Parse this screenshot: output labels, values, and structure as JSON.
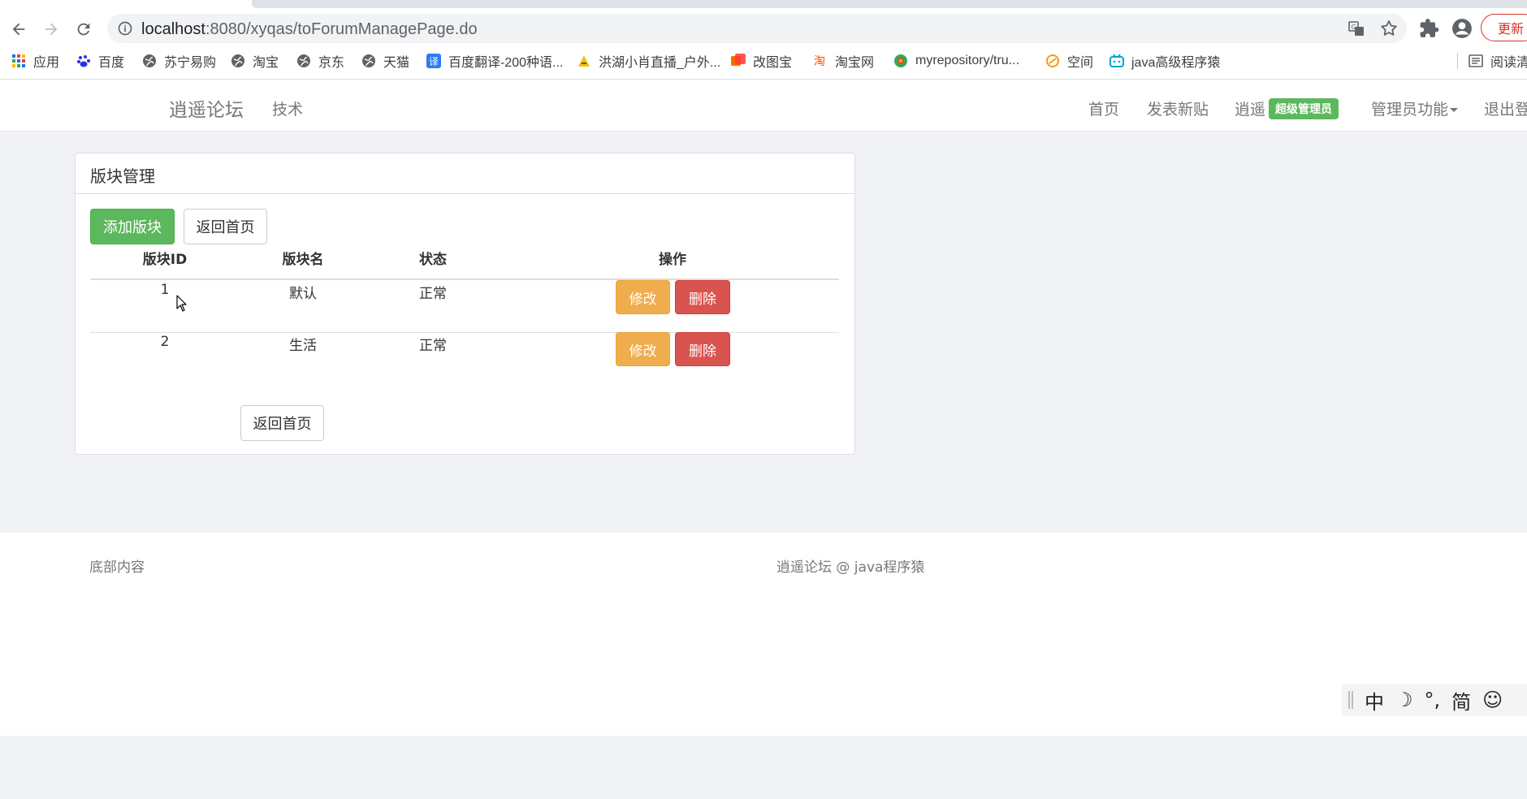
{
  "browser": {
    "url_host": "localhost",
    "url_path": ":8080/xyqas/toForumManagePage.do",
    "update_label": "更新",
    "bookmarks": [
      {
        "label": "应用",
        "icon": "apps-grid-icon"
      },
      {
        "label": "百度",
        "icon": "baidu-paw-icon"
      },
      {
        "label": "苏宁易购",
        "icon": "globe-icon"
      },
      {
        "label": "淘宝",
        "icon": "globe-icon"
      },
      {
        "label": "京东",
        "icon": "globe-icon"
      },
      {
        "label": "天猫",
        "icon": "globe-icon"
      },
      {
        "label": "百度翻译-200种语...",
        "icon": "translate-icon"
      },
      {
        "label": "洪湖小肖直播_户外...",
        "icon": "live-icon"
      },
      {
        "label": "改图宝",
        "icon": "image-tool-icon"
      },
      {
        "label": "淘宝网",
        "icon": "taobao-icon"
      },
      {
        "label": "myrepository/tru...",
        "icon": "repo-icon"
      },
      {
        "label": "空间",
        "icon": "qzone-icon"
      },
      {
        "label": "java高级程序猿",
        "icon": "bilibili-icon"
      }
    ],
    "reader_label": "阅读清"
  },
  "site_nav": {
    "brand": "逍遥论坛",
    "tech": "技术",
    "home": "首页",
    "new_post": "发表新贴",
    "username": "逍遥",
    "role_badge": "超级管理员",
    "admin_menu": "管理员功能",
    "logout": "退出登"
  },
  "panel": {
    "title": "版块管理",
    "add_button": "添加版块",
    "back_button": "返回首页",
    "back_button_bottom": "返回首页",
    "columns": [
      "版块ID",
      "版块名",
      "状态",
      "操作"
    ],
    "rows": [
      {
        "id": "1",
        "name": "默认",
        "status": "正常",
        "edit": "修改",
        "delete": "删除"
      },
      {
        "id": "2",
        "name": "生活",
        "status": "正常",
        "edit": "修改",
        "delete": "删除"
      }
    ]
  },
  "footer": {
    "left": "底部内容",
    "right": "逍遥论坛 @ java程序猿"
  },
  "ime": {
    "mode": "中",
    "moon": "☽",
    "punct": "°,",
    "script": "简",
    "emoji": "☺"
  },
  "colors": {
    "success": "#5cb85c",
    "warning": "#f0ad4e",
    "danger": "#d9534f",
    "page_bg": "#f1f2f6"
  }
}
